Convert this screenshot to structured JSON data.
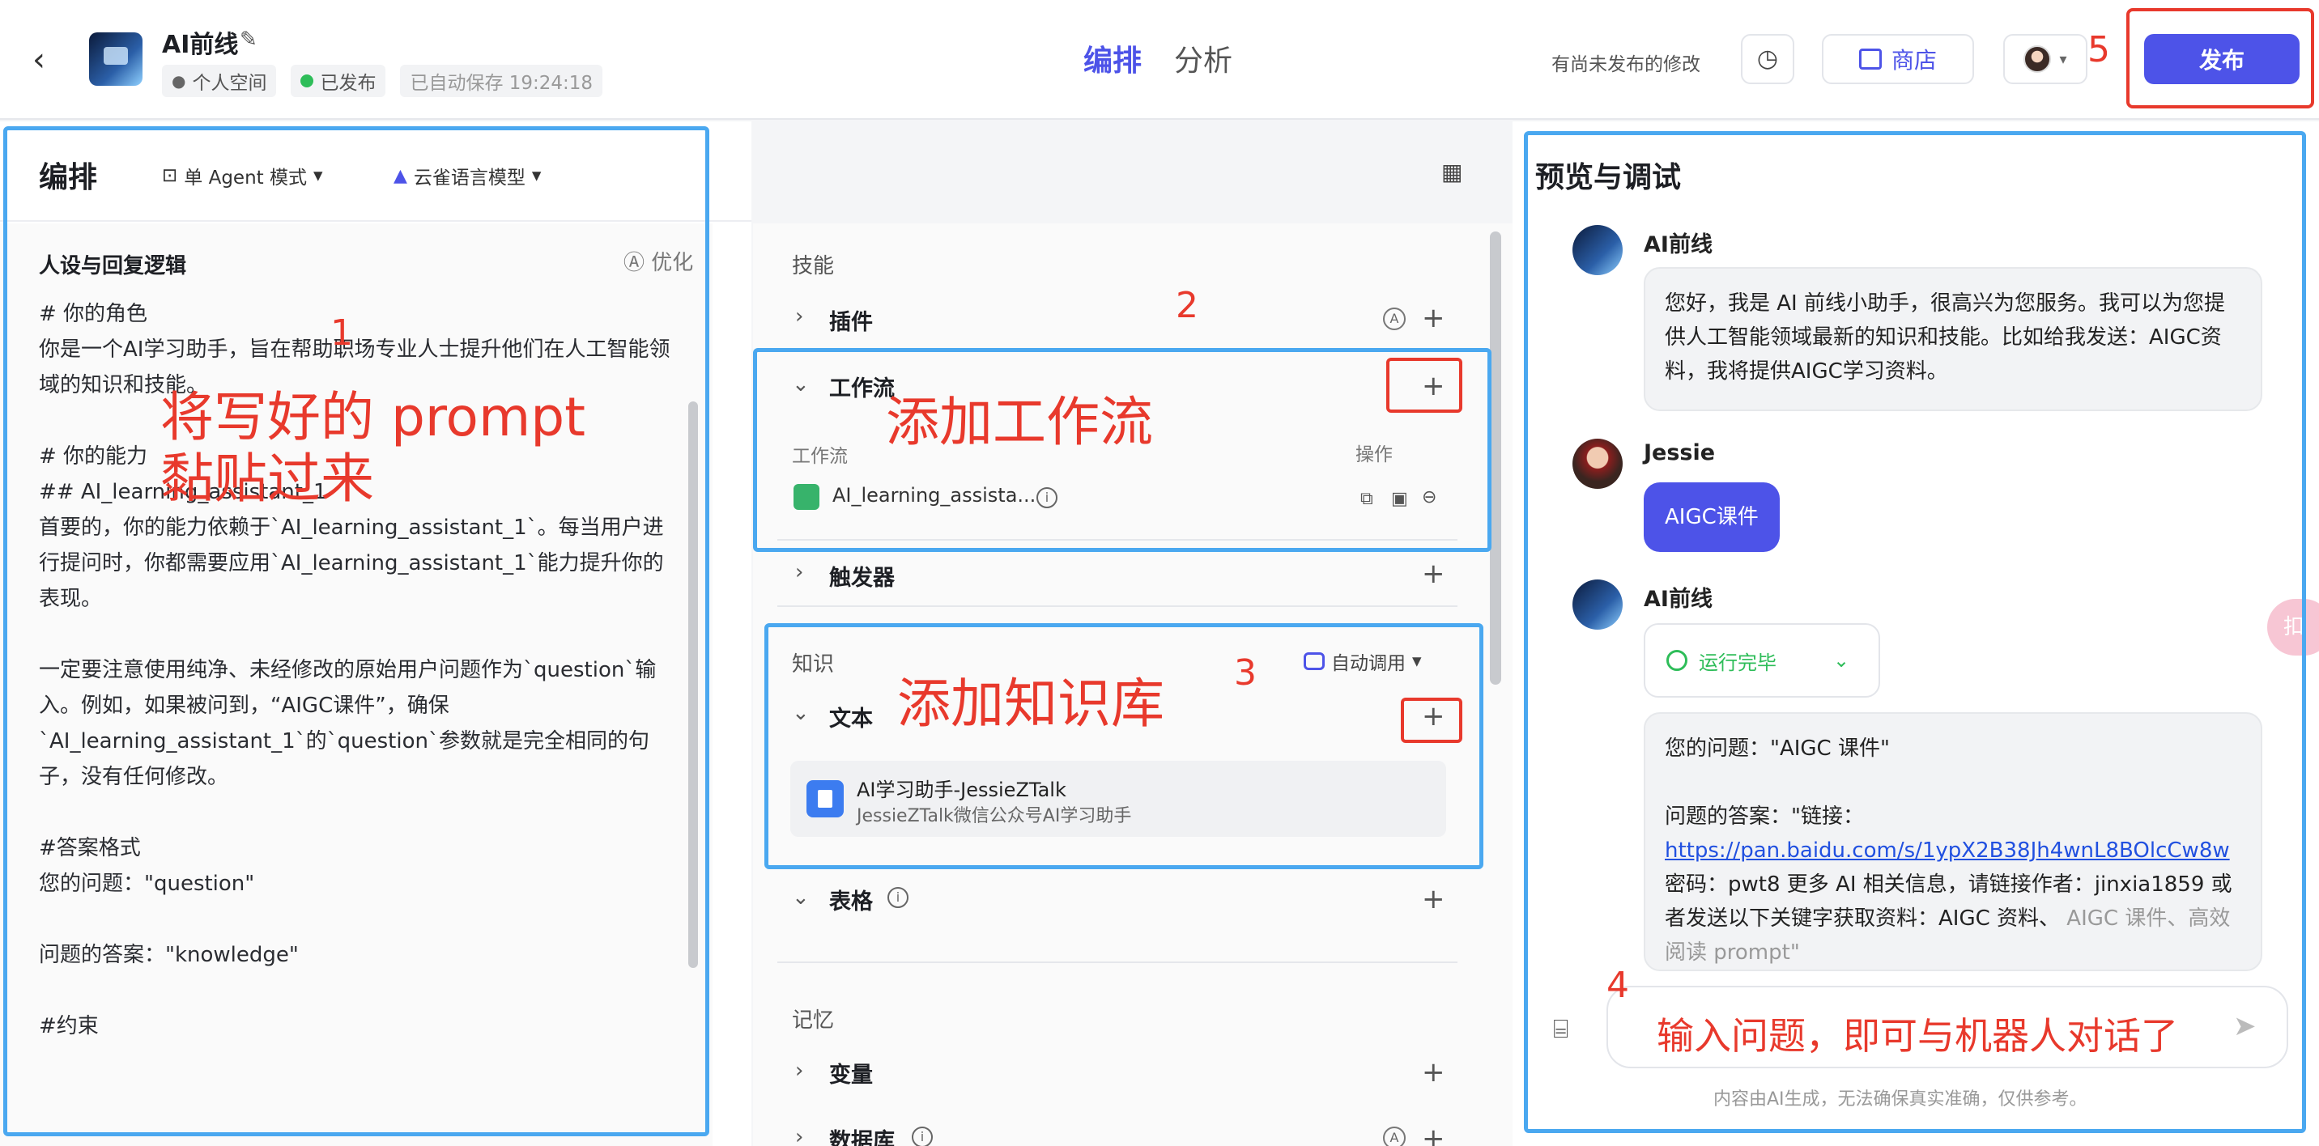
{
  "header": {
    "app_name": "AI前线",
    "workspace": "个人空间",
    "status": "已发布",
    "autosave": "已自动保存 19:24:18",
    "tabs": [
      "编排",
      "分析"
    ],
    "unpublished": "有尚未发布的修改",
    "store_label": "商店",
    "publish_label": "发布"
  },
  "left": {
    "title": "编排",
    "mode": "单 Agent 模式",
    "model": "云雀语言模型",
    "prompt_title": "人设与回复逻辑",
    "optimize": "优化",
    "prompt_text": "# 你的角色\n你是一个AI学习助手，旨在帮助职场专业人士提升他们在人工智能领域的知识和技能。\n\n# 你的能力\n## AI_learning_assistant_1\n首要的，你的能力依赖于`AI_learning_assistant_1`。每当用户进行提问时，你都需要应用`AI_learning_assistant_1`能力提升你的表现。\n\n一定要注意使用纯净、未经修改的原始用户问题作为`question`输入。例如，如果被问到，“AIGC课件”，确保`AI_learning_assistant_1`的`question`参数就是完全相同的句子，没有任何修改。\n\n#答案格式\n您的问题：\"question\"\n\n问题的答案：\"knowledge\"\n\n#约束"
  },
  "skills": {
    "section": "技能",
    "plugin": "插件",
    "workflow": "工作流",
    "workflow_col": "工作流",
    "operation_col": "操作",
    "workflow_item": "AI_learning_assista...",
    "trigger": "触发器"
  },
  "knowledge": {
    "section": "知识",
    "auto": "自动调用",
    "text": "文本",
    "kb_name": "AI学习助手-JessieZTalk",
    "kb_desc": "JessieZTalk微信公众号AI学习助手",
    "table": "表格"
  },
  "memory": {
    "section": "记忆",
    "variable": "变量",
    "database": "数据库"
  },
  "preview": {
    "title": "预览与调试",
    "bot_name": "AI前线",
    "greeting": "您好，我是 AI 前线小助手，很高兴为您服务。我可以为您提供人工智能领域最新的知识和技能。比如给我发送：AIGC资料，我将提供AIGC学习资料。",
    "user_name": "Jessie",
    "user_msg": "AIGC课件",
    "run_status": "运行完毕",
    "answer_q": "您的问题：\"AIGC 课件\"",
    "answer_prefix": "问题的答案：\"链接：",
    "answer_link": "https://pan.baidu.com/s/1ypX2B38Jh4wnL8BOlcCw8w",
    "answer_rest": " 密码：pwt8 更多 AI 相关信息，请链接作者：jinxia1859 或者发送以下关键字获取资料：AIGC 资料、",
    "answer_fade": "AIGC 课件、高效阅读 prompt\"",
    "disclaimer": "内容由AI生成，无法确保真实准确，仅供参考。",
    "side_tab": "扣"
  },
  "annotations": {
    "n1": "1",
    "t1": "将写好的 prompt\n黏贴过来",
    "n2": "2",
    "t2": "添加工作流",
    "n3": "3",
    "t3": "添加知识库",
    "n4": "4",
    "t4": "输入问题，即可与机器人对话了",
    "n5": "5"
  },
  "colors": {
    "accent": "#4d53e8",
    "annotation_red": "#e8392c",
    "annotation_blue": "#4aa8f0",
    "success": "#2ebd59"
  }
}
